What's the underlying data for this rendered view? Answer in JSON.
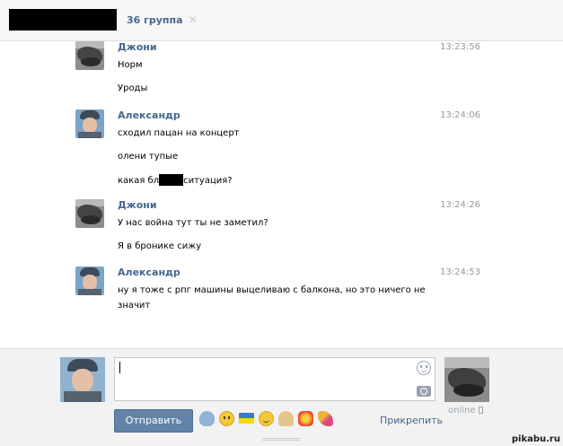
{
  "tabs": {
    "group_label": "36 группа",
    "close_glyph": "✕"
  },
  "messages": [
    {
      "author": "Джони",
      "time": "13:23:56",
      "lines": [
        "Норм",
        "Уроды"
      ]
    },
    {
      "author": "Александр",
      "time": "13:24:06",
      "lines": [
        "сходил пацан на концерт",
        "олени тупые"
      ],
      "redacted_line": {
        "before": "какая бл",
        "after": "ситуация?"
      }
    },
    {
      "author": "Джони",
      "time": "13:24:26",
      "lines": [
        "У нас война тут ты не заметил?",
        "Я в бронике сижу"
      ]
    },
    {
      "author": "Александр",
      "time": "13:24:53",
      "lines": [
        "ну я тоже с рпг машины выцеливаю с балкона, но это ничего не",
        "значит"
      ]
    }
  ],
  "composer": {
    "input_value": "",
    "send_label": "Отправить",
    "attach_label": "Прикрепить",
    "peer_status": "online",
    "emojis": [
      "whale-emoji",
      "face-emoji",
      "ukraine-flag-emoji",
      "smile-emoji",
      "shell-emoji",
      "boom-emoji",
      "party-emoji"
    ]
  },
  "watermark": "pikabu.ru",
  "colors": {
    "link": "#45688e",
    "button": "#6383a8",
    "timestamp": "#999999"
  }
}
